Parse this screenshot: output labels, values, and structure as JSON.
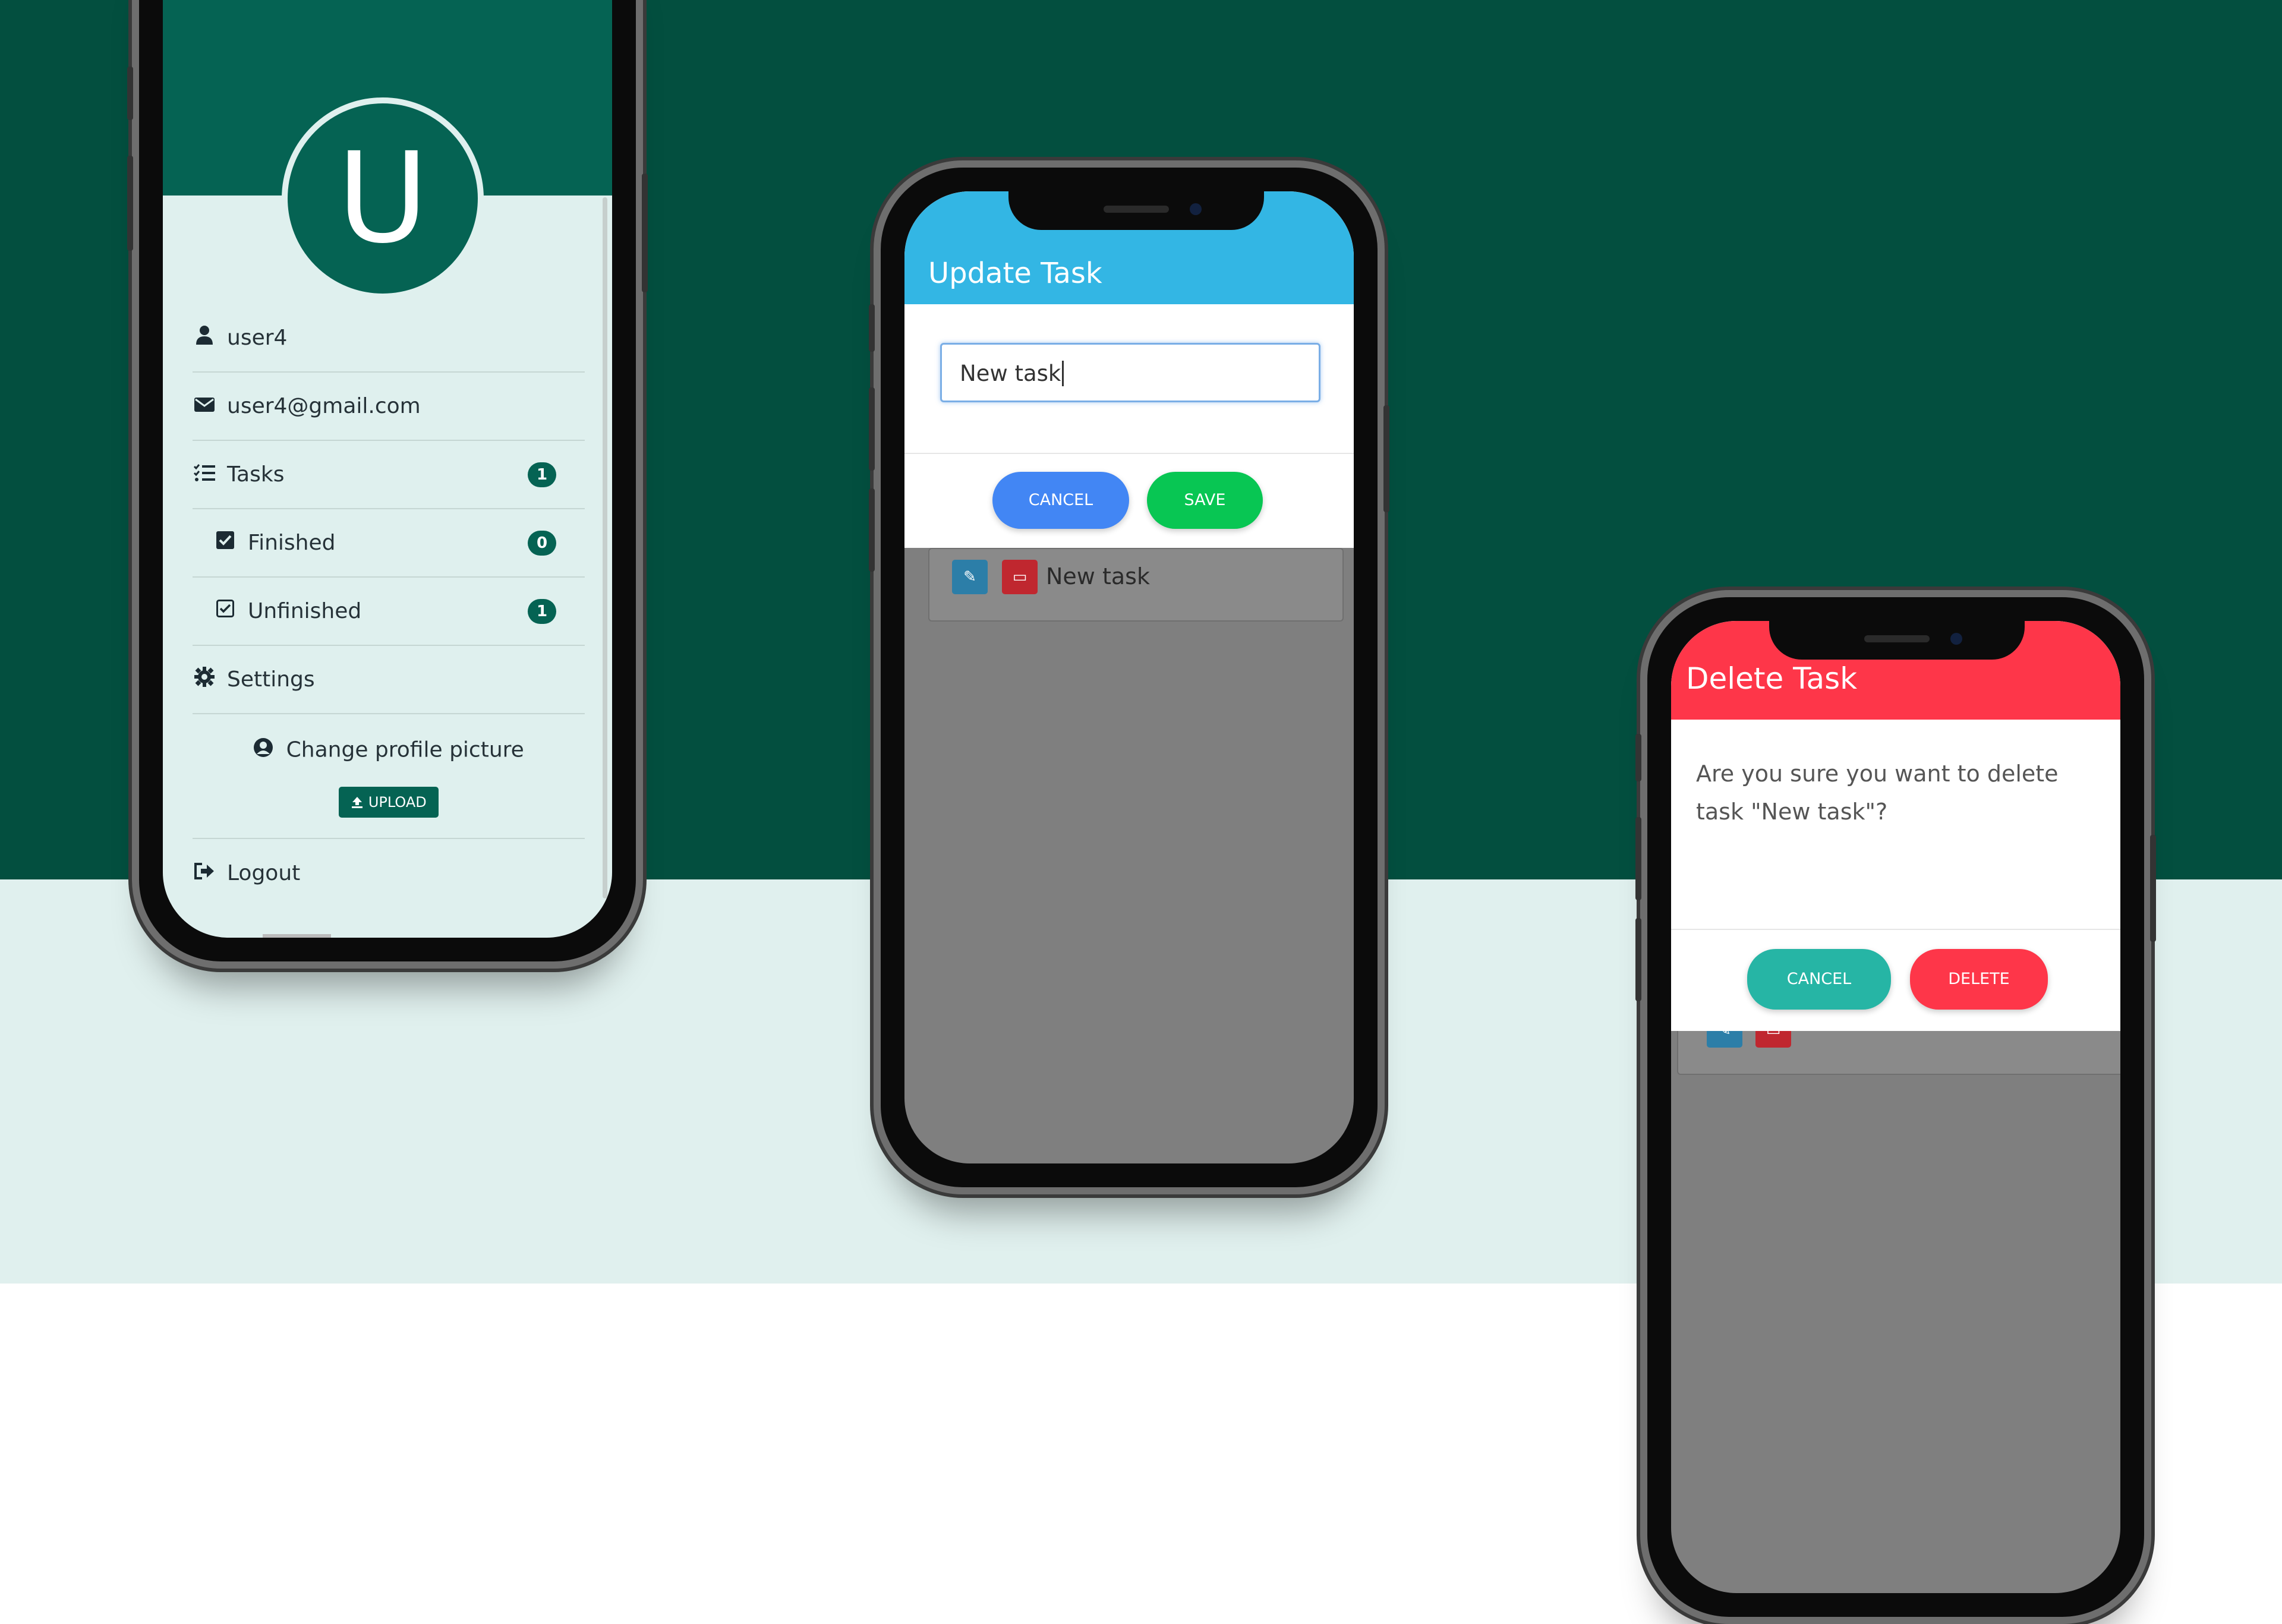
{
  "profile": {
    "avatar_letter": "U",
    "username": "user4",
    "email": "user4@gmail.com",
    "tasks_label": "Tasks",
    "tasks_count": "1",
    "finished_label": "Finished",
    "finished_count": "0",
    "unfinished_label": "Unfinished",
    "unfinished_count": "1",
    "settings_label": "Settings",
    "change_picture_label": "Change profile picture",
    "upload_label": "UPLOAD",
    "logout_label": "Logout"
  },
  "update_modal": {
    "title": "Update Task",
    "input_value": "New task",
    "cancel_label": "CANCEL",
    "save_label": "SAVE",
    "background_task": "New task"
  },
  "delete_modal": {
    "title": "Delete Task",
    "message": "Are you sure you want to delete task \"New task\"?",
    "cancel_label": "CANCEL",
    "delete_label": "DELETE"
  },
  "colors": {
    "background_dark": "#034f3f",
    "background_light": "#e0f0ee",
    "primary_green": "#056353",
    "update_header": "#33b6e4",
    "delete_header": "#fe3649",
    "cancel_blue": "#4286f4",
    "save_green": "#08c653",
    "cancel_teal": "#26b5a5",
    "delete_red": "#fe3649"
  }
}
